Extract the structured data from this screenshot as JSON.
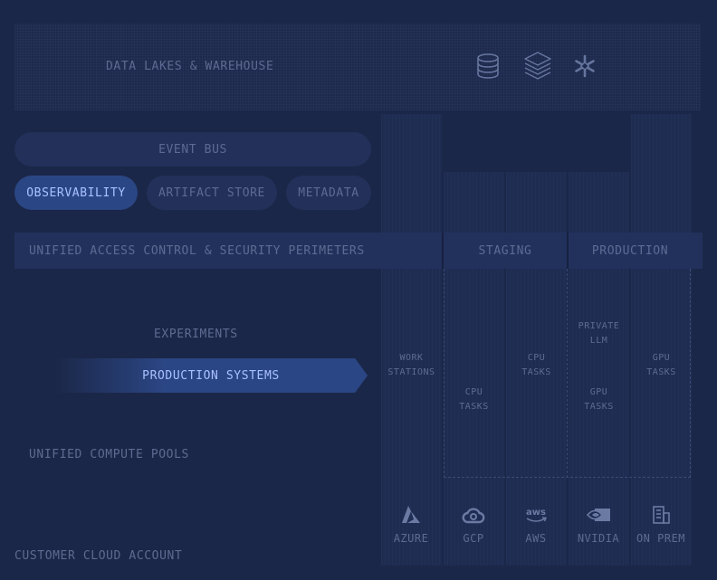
{
  "data_lakes": {
    "label": "DATA LAKES & WAREHOUSE",
    "icons": [
      "database-icon",
      "layers-stack-icon",
      "snowflake-icon"
    ]
  },
  "event_bus": "EVENT BUS",
  "services": [
    "OBSERVABILITY",
    "ARTIFACT STORE",
    "METADATA"
  ],
  "active_service": "OBSERVABILITY",
  "security_band": "UNIFIED ACCESS CONTROL & SECURITY PERIMETERS",
  "environments": {
    "staging": "STAGING",
    "production": "PRODUCTION"
  },
  "experiments": "EXPERIMENTS",
  "production_systems": "PRODUCTION SYSTEMS",
  "compute_pools": "UNIFIED COMPUTE POOLS",
  "customer_account": "CUSTOMER CLOUD ACCOUNT",
  "tasks": {
    "work_stations": [
      "WORK",
      "STATIONS"
    ],
    "gcp_cpu": [
      "CPU",
      "TASKS"
    ],
    "aws_cpu": [
      "CPU",
      "TASKS"
    ],
    "private_llm": [
      "PRIVATE",
      "LLM"
    ],
    "nvidia_gpu": [
      "GPU",
      "TASKS"
    ],
    "onprem_gpu": [
      "GPU",
      "TASKS"
    ]
  },
  "providers": [
    {
      "label": "AZURE",
      "icon": "azure-icon"
    },
    {
      "label": "GCP",
      "icon": "gcp-cloud-icon"
    },
    {
      "label": "AWS",
      "icon": "aws-icon"
    },
    {
      "label": "NVIDIA",
      "icon": "nvidia-eye-icon"
    },
    {
      "label": "ON PREM",
      "icon": "building-icon"
    }
  ],
  "colors": {
    "background": "#1b2748",
    "panel": "#22305a",
    "active": "#2b4684",
    "active_text": "#a9c2ff",
    "muted_text": "#5d6b92"
  }
}
